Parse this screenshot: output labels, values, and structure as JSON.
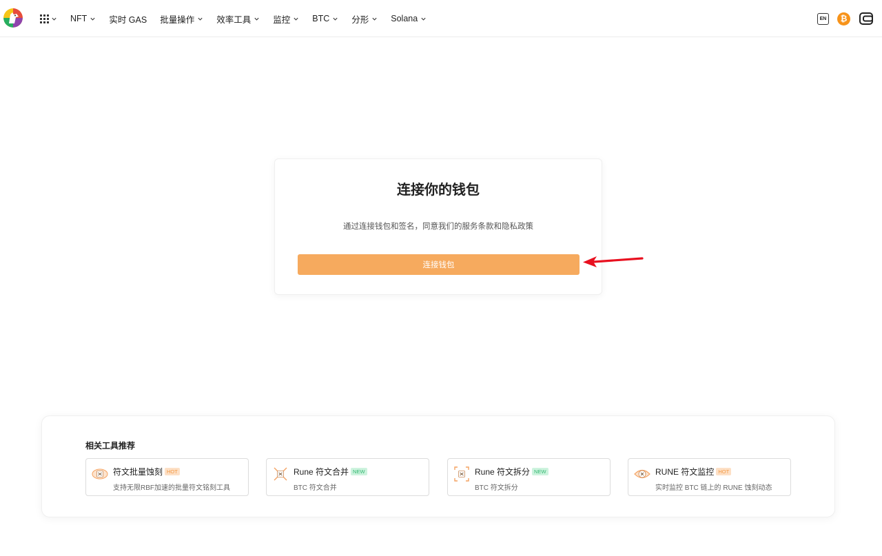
{
  "header": {
    "nav": [
      {
        "label": "NFT",
        "dropdown": true
      },
      {
        "label": "实时 GAS",
        "dropdown": false
      },
      {
        "label": "批量操作",
        "dropdown": true
      },
      {
        "label": "效率工具",
        "dropdown": true
      },
      {
        "label": "监控",
        "dropdown": true
      },
      {
        "label": "BTC",
        "dropdown": true
      },
      {
        "label": "分形",
        "dropdown": true
      },
      {
        "label": "Solana",
        "dropdown": true
      }
    ],
    "lang_label": "EN",
    "btc_symbol": "₿"
  },
  "connect": {
    "title": "连接你的钱包",
    "subtitle": "通过连接钱包和签名，同意我们的服务条款和隐私政策",
    "button_label": "连接钱包"
  },
  "tools": {
    "title": "相关工具推荐",
    "items": [
      {
        "name": "符文批量蚀刻",
        "badge": "HOT",
        "badge_type": "hot",
        "desc": "支持无限RBF加速的批量符文铭刻工具"
      },
      {
        "name": "Rune 符文合并",
        "badge": "NEW",
        "badge_type": "new",
        "desc": "BTC 符文合并"
      },
      {
        "name": "Rune 符文拆分",
        "badge": "NEW",
        "badge_type": "new",
        "desc": "BTC 符文拆分"
      },
      {
        "name": "RUNE 符文监控",
        "badge": "HOT",
        "badge_type": "hot",
        "desc": "实时监控 BTC 链上的 RUNE 蚀刻动态"
      }
    ]
  },
  "colors": {
    "accent": "#f6aa5e",
    "btc": "#f7931a",
    "annotation_arrow": "#e8101f"
  }
}
